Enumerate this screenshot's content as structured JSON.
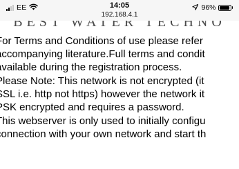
{
  "status_bar": {
    "carrier": "EE",
    "time": "14:05",
    "address": "192.168.4.1",
    "battery_percent": "96%",
    "battery_level": 0.96,
    "icons": [
      "signal-icon",
      "wifi-icon",
      "location-arrow-icon",
      "battery-icon"
    ]
  },
  "header": {
    "logo_text": "BEST WATER TECHNO"
  },
  "body": {
    "lines": [
      "For Terms and Conditions of use please refer",
      "accompanying literature.Full terms and condit",
      "available during the registration process.",
      "Please Note: This network is not encrypted (it",
      "SSL i.e. http not https) however the network it",
      "PSK encrypted and requires a password.",
      "This webserver is only used to initially configu",
      "connection with your own network and start th"
    ]
  }
}
